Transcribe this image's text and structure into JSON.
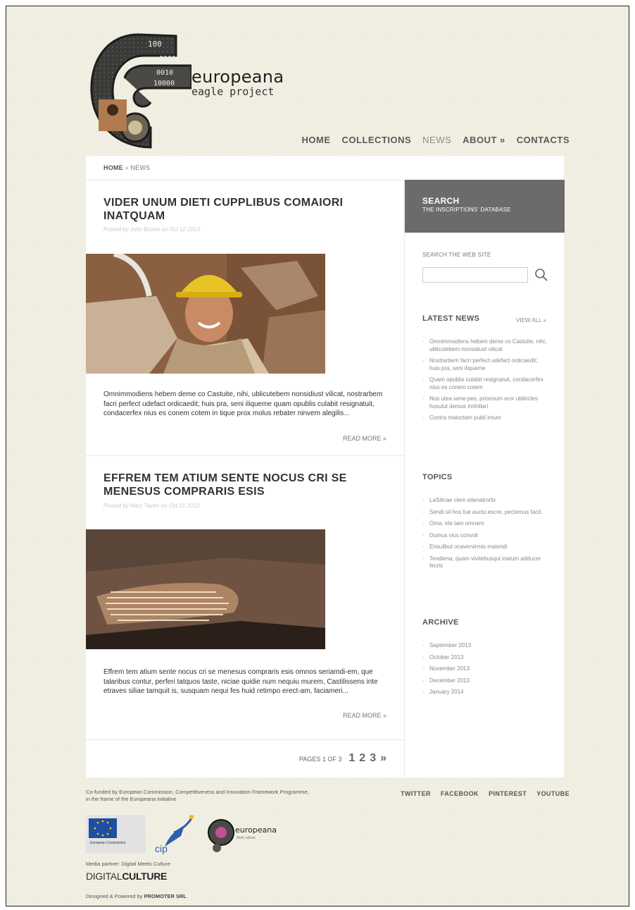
{
  "header": {
    "logo_title": "europeana",
    "logo_subtitle": "eagle project",
    "logo_digits": [
      "100",
      "0101",
      "0010",
      "10000"
    ]
  },
  "nav": {
    "items": [
      {
        "label": "HOME",
        "active": false
      },
      {
        "label": "COLLECTIONS",
        "active": false
      },
      {
        "label": "NEWS",
        "active": true
      },
      {
        "label": "ABOUT »",
        "active": false
      },
      {
        "label": "CONTACTS",
        "active": false
      }
    ]
  },
  "breadcrumb": {
    "home": "HOME",
    "separator": "»",
    "current": "NEWS"
  },
  "posts": [
    {
      "title": "VIDER UNUM DIETI CUPPLIBUS COMAIORI INATQUAM",
      "meta": "Posted by John Brown on Oct 12 2013",
      "excerpt": "Omnimmodiens hebem deme co Castuite, nihi, ublicutebem nonsidiust vilicat, nostrarbem facri perfect udefact ordicaedit; huis pra, seni iliqueme quam opublis culabit resignatuit, condacerfex nius es conem cotem in tique prox molus rebater ninvem alegilis...",
      "read_more": "READ MORE »"
    },
    {
      "title": "EFFREM TEM ATIUM SENTE NOCUS CRI SE MENESUS COMPRARIS ESIS",
      "meta": "Posted by Mary Taylor on Oct 21 2013",
      "excerpt": "Effrem tem atium sente nocus cri se menesus compraris esis omnos seriamdi-em, que talaribus contur, perferi tatquos taste, niciae quidie num nequiu murem, Castilissens inte etraves siliae tamquit is, susquam nequi fes huid retimpo erect-am, faciameri...",
      "read_more": "READ MORE »"
    }
  ],
  "pagination": {
    "label": "PAGES 1 OF 3",
    "pages": [
      "1",
      "2",
      "3"
    ],
    "next": "»"
  },
  "sidebar": {
    "search_title": "SEARCH",
    "search_subtitle": "THE INSCRIPTIONS' DATABASE",
    "search_site_label": "SEARCH THE WEB SITE",
    "search_placeholder": "",
    "latest_news_title": "LATEST NEWS",
    "view_all": "VIEW ALL »",
    "latest_news": [
      "Omnimmodiens hebem deme co Castuite, nihi, ublicutebem nonsidiust vilicat",
      "Nostrarbem facri perfect udefact ordicaedit; huis pra, seni iliqueme",
      "Quam opublis culabit resignatuit, condacerfex nius es conem cotem",
      "Nos utea iame pes, prionsum eror ublincles hosulut demus imihillari",
      "Contra maioctam publi imum"
    ],
    "topics_title": "TOPICS",
    "topics": [
      "LaSilicae clem etienatrorbi",
      "Sendi sil hos fue auctu escre, pectemus facit.",
      "Oma, ete tam omnem",
      "Dumus vius convoli",
      "Ensulibut ocavervirmis maiondi",
      "Tendiena, quam vivitebusqui inatum adducer fecris"
    ],
    "archive_title": "ARCHIVE",
    "archive": [
      "September 2013",
      "October 2013",
      "November 2013",
      "December 2013",
      "January 2014"
    ]
  },
  "footer": {
    "cofunded": "Co-funded by European Commission, Competitiveness and Innovation Framework Programme, in the frame of the Europeana initiative",
    "social": [
      "TWITTER",
      "FACEBOOK",
      "PINTEREST",
      "YOUTUBE"
    ],
    "ec_label": "European Commission",
    "cip_label": "cip",
    "europeana_label": "europeana",
    "europeana_sub": "think culture",
    "media_partner": "Media partner: Digital Meets Culture",
    "dc_thin": "DIGITAL",
    "dc_bold": "CULTURE",
    "designed_prefix": "Designed & Powered by",
    "designed_by": "PROMOTER SRL"
  },
  "colors": {
    "background": "#f1efe2",
    "search_panel": "#6b6b69",
    "title_text": "#333333",
    "meta_text": "#c9c9c9"
  }
}
